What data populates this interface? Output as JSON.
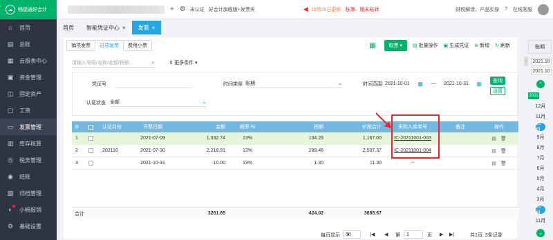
{
  "brand": {
    "name": "畅捷通好会计"
  },
  "sidebar": {
    "items": [
      {
        "label": "首页",
        "icon": "home-icon"
      },
      {
        "label": "总账",
        "icon": "ledger-icon"
      },
      {
        "label": "云报表中心",
        "icon": "report-icon"
      },
      {
        "label": "资金管理",
        "icon": "funds-icon"
      },
      {
        "label": "固定资产",
        "icon": "asset-icon"
      },
      {
        "label": "工资",
        "icon": "salary-icon"
      },
      {
        "label": "发票管理",
        "icon": "invoice-icon",
        "active": true
      },
      {
        "label": "库存核算",
        "icon": "inventory-icon"
      },
      {
        "label": "税务管理",
        "icon": "tax-icon"
      },
      {
        "label": "结账",
        "icon": "close-books-icon"
      },
      {
        "label": "归档管理",
        "icon": "archive-icon"
      },
      {
        "label": "小畅报销",
        "icon": "reimburse-icon",
        "badge": true
      },
      {
        "label": "基础设置",
        "icon": "settings-icon"
      }
    ]
  },
  "topbar": {
    "uncertified": "未认证",
    "company": "好会计旗舰版+发票夹",
    "news_date": "10月26日更新",
    "news_link": "账簿、期末结转",
    "promo": "财税解读、产品实操",
    "support": "在线客服"
  },
  "tabs": [
    {
      "label": "首页",
      "closable": false,
      "active": false
    },
    {
      "label": "智能凭证中心",
      "closable": true,
      "active": false
    },
    {
      "label": "发票",
      "closable": true,
      "active": true
    }
  ],
  "subtabs": [
    {
      "label": "销项发票",
      "active": false
    },
    {
      "label": "进项发票",
      "active": true
    },
    {
      "label": "费用小票",
      "active": false
    }
  ],
  "actions": {
    "invoice_dropdown": "取票",
    "batch": "批量操作",
    "gen_voucher": "生成凭证",
    "add": "新增",
    "refresh": "刷新"
  },
  "search": {
    "placeholder": "请输入号码/名称/金额/税额...",
    "more": "更多条件"
  },
  "filter": {
    "voucher_label": "凭证号",
    "time_type_label": "时间类型",
    "time_type_value": "账期",
    "range_label": "时间范围",
    "date_from": "2021-10-01",
    "date_sep": "—",
    "date_to": "2021-10-31",
    "cert_label": "认证状态",
    "cert_value": "全部",
    "query_btn": "查询",
    "reset_btn": "设置"
  },
  "table": {
    "headers": {
      "cert_month": "认证月份",
      "date": "开票日期",
      "amount": "金额",
      "rate": "税率",
      "tax": "税额",
      "total": "价税合计",
      "receipt": "采购入库单号",
      "note": "备注",
      "op": "操作"
    },
    "rows": [
      {
        "idx": "1",
        "cert_month": "",
        "date": "2021-07-09",
        "amount": "1,032.74",
        "rate": "13%",
        "tax": "134.26",
        "total": "1,167.00",
        "receipt": "IC-20211001-003",
        "note": ""
      },
      {
        "idx": "2",
        "cert_month": "202110",
        "date": "2021-07-30",
        "amount": "2,218.91",
        "rate": "13%",
        "tax": "288.46",
        "total": "2,507.37",
        "receipt": "IC-20211001-004",
        "note": ""
      },
      {
        "idx": "3",
        "cert_month": "",
        "date": "2021-10-31",
        "amount": "10.00",
        "rate": "13%",
        "tax": "1.30",
        "total": "11.30",
        "receipt": "--",
        "note": ""
      }
    ],
    "totals": {
      "label": "合计",
      "amount": "3261.65",
      "tax": "424.02",
      "total": "3685.67"
    }
  },
  "pager": {
    "per_page_label": "每页显示",
    "per_page": "50",
    "page_label_pre": "第",
    "page": "1",
    "page_label_post": "页",
    "summary": "共1页, 3条记录"
  },
  "right_panel": {
    "title": "账期",
    "chips": [
      "2021.10",
      "2021.10"
    ],
    "year": "2021",
    "months": [
      "12月",
      "11月",
      "10月",
      "9月",
      "8月",
      "7月",
      "6月",
      "5月",
      "4月",
      "3月",
      "10月",
      "11月"
    ],
    "active_month": "10月"
  },
  "colors": {
    "accent": "#26a6e0",
    "green": "#00b36b",
    "header": "#72b8e1",
    "highlight": "#f5222d"
  }
}
